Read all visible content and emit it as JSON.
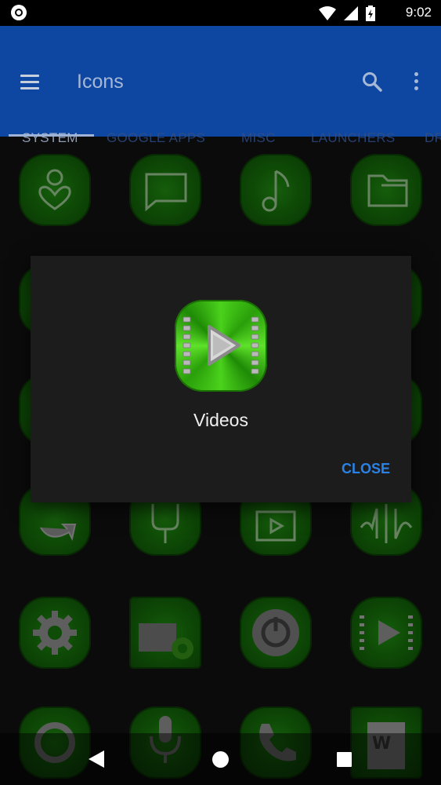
{
  "status_bar": {
    "time": "9:02",
    "icons": [
      "record-icon",
      "wifi-icon",
      "cell-signal-icon",
      "battery-charging-icon"
    ]
  },
  "app_bar": {
    "title": "Icons",
    "menu_icon": "menu-icon",
    "search_icon": "search-icon",
    "more_icon": "more-vert-icon",
    "color": "#0d47a1"
  },
  "tabs": [
    {
      "label": "SYSTEM",
      "active": true
    },
    {
      "label": "GOOGLE APPS",
      "active": false
    },
    {
      "label": "MISC",
      "active": false
    },
    {
      "label": "LAUNCHERS",
      "active": false
    },
    {
      "label": "DR",
      "active": false
    }
  ],
  "grid_icons": [
    "heart-person-icon",
    "message-icon",
    "music-note-icon",
    "folder-icon",
    "icon-partial",
    "icon-partial",
    "icon-partial",
    "icon-partial",
    "icon-partial",
    "icon-partial",
    "icon-partial",
    "icon-partial",
    "sync-icon",
    "brush-icon",
    "video-folder-icon",
    "waveform-icon",
    "settings-gear-icon",
    "sd-card-settings-icon",
    "power-icon",
    "video-icon",
    "record-icon",
    "microphone-icon",
    "phone-icon",
    "word-document-icon"
  ],
  "dialog": {
    "icon": "videos-icon",
    "title": "Videos",
    "close_label": "CLOSE"
  },
  "colors": {
    "accent_green": "#4bd21c",
    "close_button": "#2a82e6",
    "tab_active": "#a7b8d6",
    "tab_inactive": "#2e4d87"
  },
  "nav_bar": {
    "back_icon": "back-icon",
    "home_icon": "home-icon",
    "recents_icon": "recents-icon"
  }
}
